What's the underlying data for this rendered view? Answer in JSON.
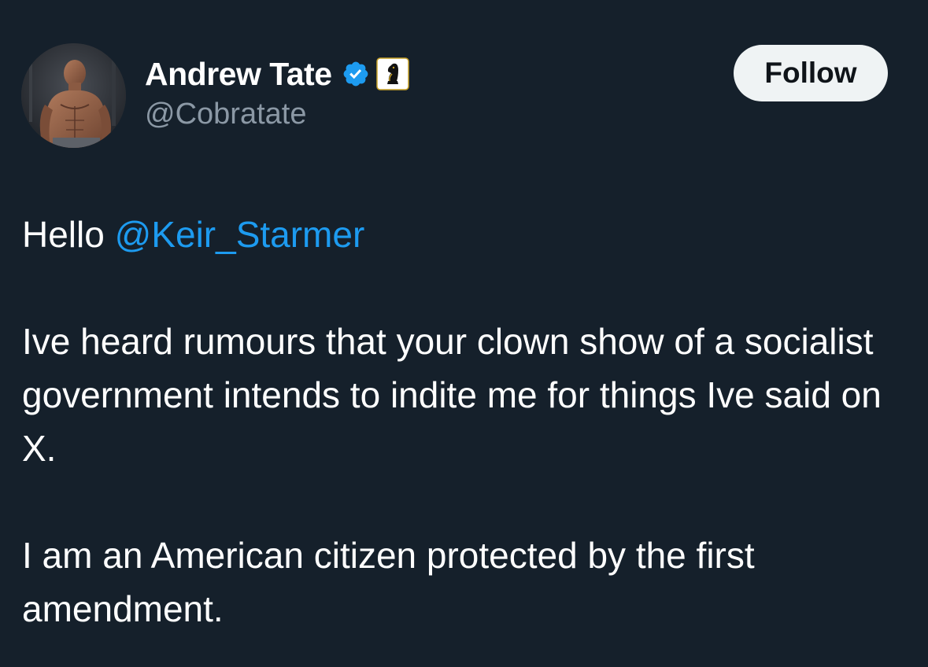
{
  "author": {
    "display_name": "Andrew Tate",
    "handle": "@Cobratate",
    "verified": true,
    "verified_color": "#1d9bf0",
    "affiliate_badge_icon": "knight-chess-piece-icon"
  },
  "follow_button": {
    "label": "Follow"
  },
  "tweet": {
    "greeting": "Hello",
    "mention": "@Keir_Starmer",
    "paragraph_1": "Ive heard rumours that your clown show of a socialist government intends to indite me for things Ive said on X.",
    "paragraph_2": "I am an American citizen protected by the first amendment."
  },
  "colors": {
    "background": "#15202b",
    "text": "#ffffff",
    "secondary_text": "#8b98a5",
    "link": "#1d9bf0",
    "button_bg": "#eff3f4"
  }
}
